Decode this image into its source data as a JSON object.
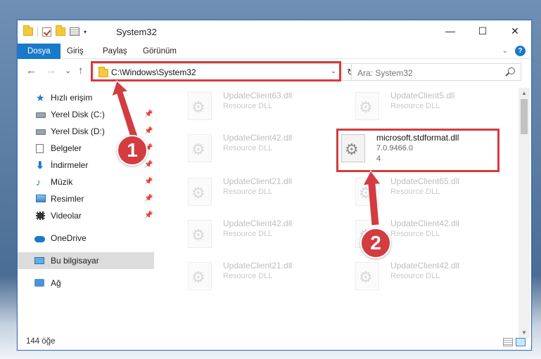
{
  "window": {
    "title": "System32",
    "minimize_glyph": "—",
    "maximize_glyph": "☐",
    "close_glyph": "✕"
  },
  "quick_access": {
    "dropdown_glyph": "▾"
  },
  "ribbon": {
    "tabs": [
      "Dosya",
      "Giriş",
      "Paylaş",
      "Görünüm"
    ],
    "collapse_glyph": "⌄",
    "help_glyph": "?"
  },
  "nav": {
    "back_glyph": "←",
    "forward_glyph": "→",
    "recent_glyph": "⌄",
    "up_glyph": "↑",
    "address": "C:\\Windows\\System32",
    "address_dropdown_glyph": "⌄",
    "refresh_glyph": "↻",
    "search_placeholder": "Ara: System32"
  },
  "sidebar": {
    "items": [
      {
        "label": "Hızlı erişim",
        "icon": "star-icon"
      },
      {
        "label": "Yerel Disk (C:)",
        "icon": "drive-icon",
        "pinned": true
      },
      {
        "label": "Yerel Disk (D:)",
        "icon": "drive-icon",
        "pinned": true
      },
      {
        "label": "Belgeler",
        "icon": "document-icon",
        "pinned": true
      },
      {
        "label": "İndirmeler",
        "icon": "download-icon",
        "pinned": true
      },
      {
        "label": "Müzik",
        "icon": "music-icon",
        "pinned": true
      },
      {
        "label": "Resimler",
        "icon": "pictures-icon",
        "pinned": true
      },
      {
        "label": "Videolar",
        "icon": "videos-icon",
        "pinned": true
      },
      {
        "label": "OneDrive",
        "icon": "cloud-icon"
      },
      {
        "label": "Bu bilgisayar",
        "icon": "computer-icon",
        "selected": true
      },
      {
        "label": "Ağ",
        "icon": "network-icon"
      }
    ],
    "pin_glyph": "📌"
  },
  "files": [
    {
      "name": "UpdateClient63.dll",
      "desc": "Resource DLL"
    },
    {
      "name": "UpdateClient5.dll",
      "desc": "Resource DLL"
    },
    {
      "name": "UpdateClient42.dll",
      "desc": "Resource DLL"
    },
    {
      "name": "microsoft.stdformat.dll",
      "version": "7.0.9466.0",
      "extra": "4",
      "highlighted": true
    },
    {
      "name": "UpdateClient21.dll",
      "desc": "Resource DLL"
    },
    {
      "name": "UpdateClient65.dll",
      "desc": "Resource DLL"
    },
    {
      "name": "UpdateClient42.dll",
      "desc": "Resource DLL"
    },
    {
      "name": "UpdateClient42.dll",
      "desc": "Resource DLL"
    },
    {
      "name": "UpdateClient21.dll",
      "desc": "Resource DLL"
    },
    {
      "name": "UpdateClient42.dll",
      "desc": "Resource DLL"
    }
  ],
  "scrollbar": {
    "up_glyph": "▲",
    "down_glyph": "▼"
  },
  "status": {
    "item_count": "144 öğe"
  },
  "annotations": {
    "callout1": "1",
    "callout2": "2",
    "color": "#d33c40"
  }
}
